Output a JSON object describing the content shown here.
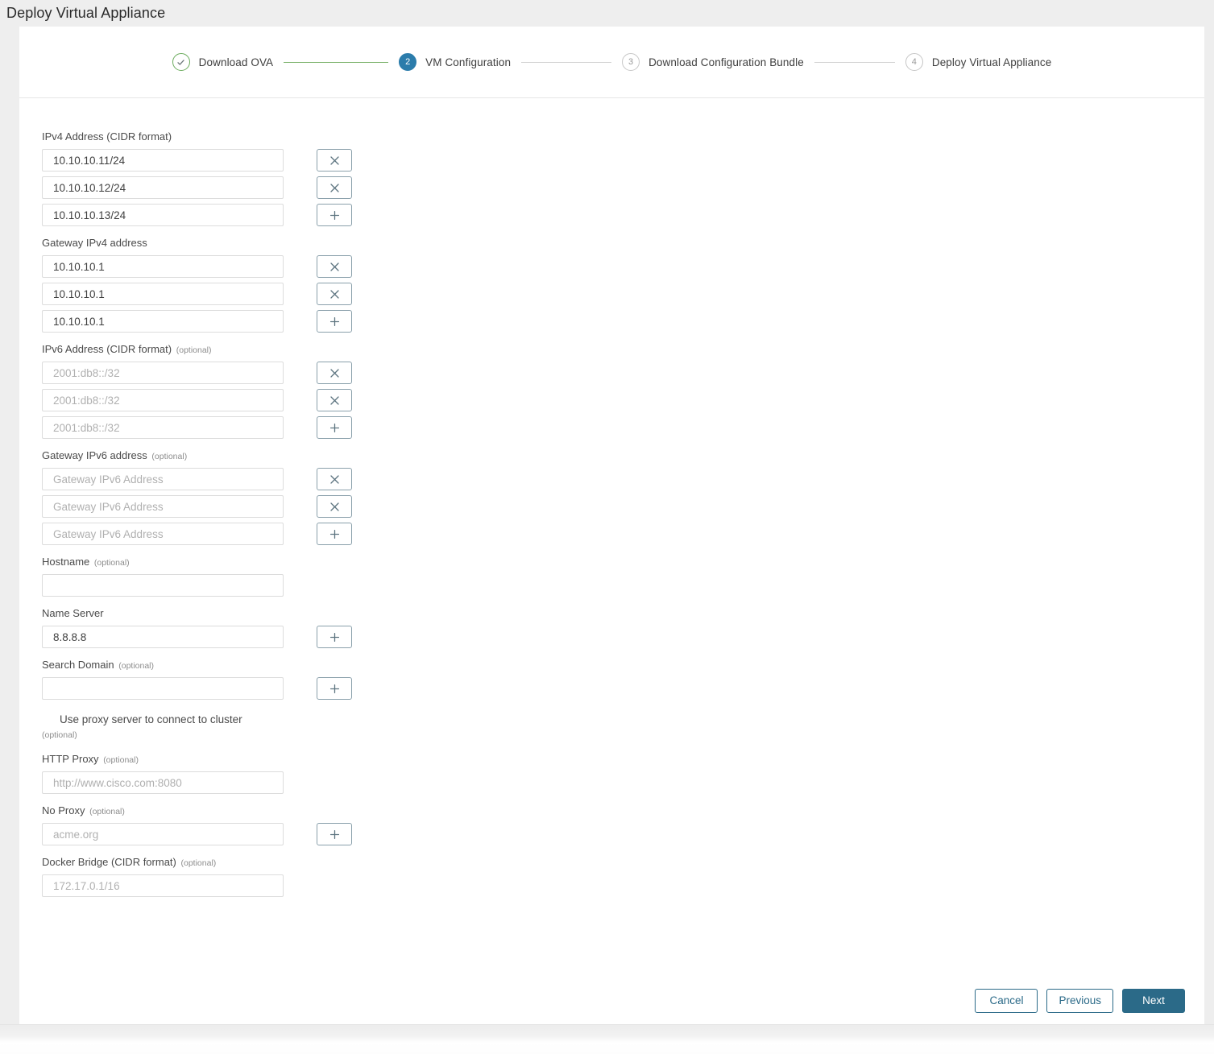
{
  "window": {
    "title": "Deploy Virtual Appliance"
  },
  "stepper": {
    "steps": [
      {
        "number": "1",
        "label": "Download OVA",
        "state": "done",
        "icon": "check-icon"
      },
      {
        "number": "2",
        "label": "VM Configuration",
        "state": "active"
      },
      {
        "number": "3",
        "label": "Download Configuration Bundle",
        "state": "pending"
      },
      {
        "number": "4",
        "label": "Deploy Virtual Appliance",
        "state": "pending"
      }
    ]
  },
  "form": {
    "ipv4": {
      "label": "IPv4 Address (CIDR format)",
      "optional": "",
      "rows": [
        {
          "value": "10.10.10.11/24",
          "placeholder": "",
          "action": "remove",
          "action_icon": "close-icon"
        },
        {
          "value": "10.10.10.12/24",
          "placeholder": "",
          "action": "remove",
          "action_icon": "close-icon"
        },
        {
          "value": "10.10.10.13/24",
          "placeholder": "",
          "action": "add",
          "action_icon": "plus-icon"
        }
      ]
    },
    "gateway_ipv4": {
      "label": "Gateway IPv4 address",
      "optional": "",
      "rows": [
        {
          "value": "10.10.10.1",
          "placeholder": "",
          "action": "remove",
          "action_icon": "close-icon"
        },
        {
          "value": "10.10.10.1",
          "placeholder": "",
          "action": "remove",
          "action_icon": "close-icon"
        },
        {
          "value": "10.10.10.1",
          "placeholder": "",
          "action": "add",
          "action_icon": "plus-icon"
        }
      ]
    },
    "ipv6": {
      "label": "IPv6 Address (CIDR format)",
      "optional": "(optional)",
      "rows": [
        {
          "value": "",
          "placeholder": "2001:db8::/32",
          "action": "remove",
          "action_icon": "close-icon"
        },
        {
          "value": "",
          "placeholder": "2001:db8::/32",
          "action": "remove",
          "action_icon": "close-icon"
        },
        {
          "value": "",
          "placeholder": "2001:db8::/32",
          "action": "add",
          "action_icon": "plus-icon"
        }
      ]
    },
    "gateway_ipv6": {
      "label": "Gateway IPv6 address",
      "optional": "(optional)",
      "rows": [
        {
          "value": "",
          "placeholder": "Gateway IPv6 Address",
          "action": "remove",
          "action_icon": "close-icon"
        },
        {
          "value": "",
          "placeholder": "Gateway IPv6 Address",
          "action": "remove",
          "action_icon": "close-icon"
        },
        {
          "value": "",
          "placeholder": "Gateway IPv6 Address",
          "action": "add",
          "action_icon": "plus-icon"
        }
      ]
    },
    "hostname": {
      "label": "Hostname",
      "optional": "(optional)",
      "rows": [
        {
          "value": "",
          "placeholder": "",
          "action": "none",
          "action_icon": ""
        }
      ]
    },
    "name_server": {
      "label": "Name Server",
      "optional": "",
      "rows": [
        {
          "value": "8.8.8.8",
          "placeholder": "",
          "action": "add",
          "action_icon": "plus-icon"
        }
      ]
    },
    "search_domain": {
      "label": "Search Domain",
      "optional": "(optional)",
      "rows": [
        {
          "value": "",
          "placeholder": "",
          "action": "add",
          "action_icon": "plus-icon"
        }
      ]
    },
    "proxy_toggle": {
      "label": "Use proxy server to connect to cluster",
      "optional": "(optional)"
    },
    "http_proxy": {
      "label": "HTTP Proxy",
      "optional": "(optional)",
      "rows": [
        {
          "value": "",
          "placeholder": "http://www.cisco.com:8080",
          "action": "none",
          "action_icon": ""
        }
      ]
    },
    "no_proxy": {
      "label": "No Proxy",
      "optional": "(optional)",
      "rows": [
        {
          "value": "",
          "placeholder": "acme.org",
          "action": "add",
          "action_icon": "plus-icon"
        }
      ]
    },
    "docker_bridge": {
      "label": "Docker Bridge (CIDR format)",
      "optional": "(optional)",
      "rows": [
        {
          "value": "",
          "placeholder": "172.17.0.1/16",
          "action": "none",
          "action_icon": ""
        }
      ]
    }
  },
  "footer": {
    "cancel_label": "Cancel",
    "previous_label": "Previous",
    "next_label": "Next"
  },
  "colors": {
    "accent_blue": "#2b7cab",
    "primary_button": "#2b6a88",
    "step_done_green": "#6aab5c",
    "connector_green": "#7cb36c",
    "icon_button_border": "#8aa0ab",
    "topbar_bg": "#eeeeee"
  }
}
